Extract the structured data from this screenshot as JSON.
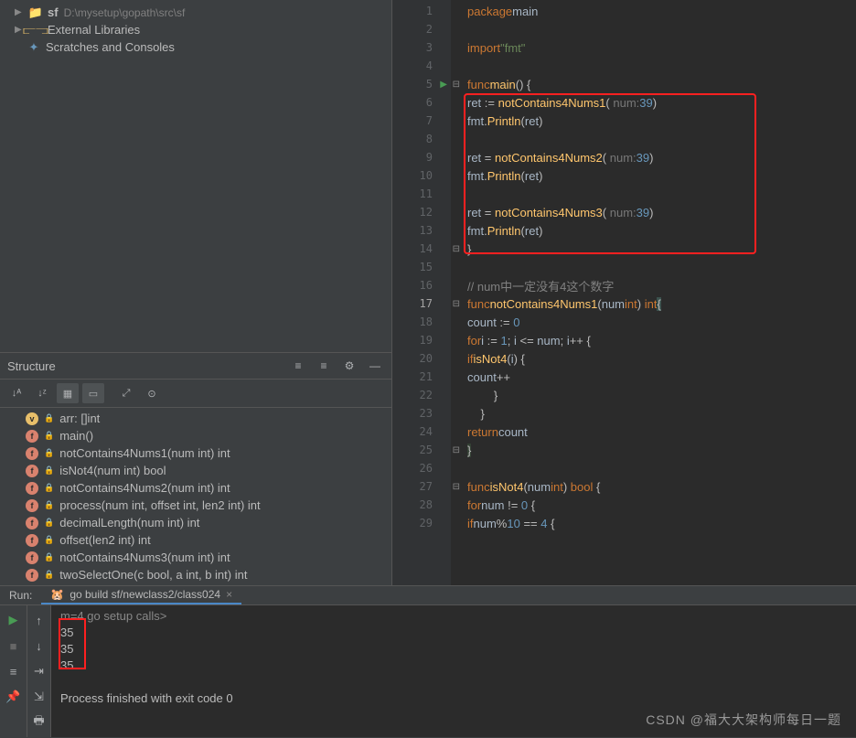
{
  "project": {
    "root_name": "sf",
    "root_path": "D:\\mysetup\\gopath\\src\\sf",
    "external_libs": "External Libraries",
    "scratches": "Scratches and Consoles"
  },
  "structure": {
    "title": "Structure",
    "items": [
      {
        "badge": "v",
        "label": "arr: []int"
      },
      {
        "badge": "f",
        "label": "main()"
      },
      {
        "badge": "f",
        "label": "notContains4Nums1(num int) int"
      },
      {
        "badge": "f",
        "label": "isNot4(num int) bool"
      },
      {
        "badge": "f",
        "label": "notContains4Nums2(num int) int"
      },
      {
        "badge": "f",
        "label": "process(num int, offset int, len2 int) int"
      },
      {
        "badge": "f",
        "label": "decimalLength(num int) int"
      },
      {
        "badge": "f",
        "label": "offset(len2 int) int"
      },
      {
        "badge": "f",
        "label": "notContains4Nums3(num int) int"
      },
      {
        "badge": "f",
        "label": "twoSelectOne(c bool, a int, b int) int"
      }
    ]
  },
  "editor": {
    "active_line": 17,
    "breadcrumb": "notContains4Nums1(num int) int",
    "lines": [
      {
        "n": 1,
        "html": "<span class='kw'>package</span> <span class='id'>main</span>"
      },
      {
        "n": 2,
        "html": ""
      },
      {
        "n": 3,
        "html": "<span class='kw'>import</span> <span class='str'>\"fmt\"</span>"
      },
      {
        "n": 4,
        "html": ""
      },
      {
        "n": 5,
        "html": "<span class='kw'>func</span> <span class='fn'>main</span>() {",
        "run": true,
        "fold": "-"
      },
      {
        "n": 6,
        "html": "    <span class='id'>ret</span> := <span class='fn'>notContains4Nums1</span>( <span class='param-hint'>num:</span> <span class='num'>39</span>)"
      },
      {
        "n": 7,
        "html": "    <span class='id'>fmt</span>.<span class='fn'>Println</span>(<span class='id'>ret</span>)"
      },
      {
        "n": 8,
        "html": ""
      },
      {
        "n": 9,
        "html": "    <span class='id'>ret</span> = <span class='fn'>notContains4Nums2</span>( <span class='param-hint'>num:</span> <span class='num'>39</span>)"
      },
      {
        "n": 10,
        "html": "    <span class='id'>fmt</span>.<span class='fn'>Println</span>(<span class='id'>ret</span>)"
      },
      {
        "n": 11,
        "html": ""
      },
      {
        "n": 12,
        "html": "    <span class='id'>ret</span> = <span class='fn'>notContains4Nums3</span>( <span class='param-hint'>num:</span> <span class='num'>39</span>)"
      },
      {
        "n": 13,
        "html": "    <span class='id'>fmt</span>.<span class='fn'>Println</span>(<span class='id'>ret</span>)"
      },
      {
        "n": 14,
        "html": "}",
        "fold": "-"
      },
      {
        "n": 15,
        "html": ""
      },
      {
        "n": 16,
        "html": "<span class='cm'>// num中一定没有4这个数字</span>"
      },
      {
        "n": 17,
        "html": "<span class='kw'>func</span> <span class='fn'>notContains4Nums1</span>(<span class='id'>num</span> <span class='kw'>int</span>) <span class='kw'>int</span> <span class='hl-br'>{</span>",
        "fold": "-"
      },
      {
        "n": 18,
        "html": "    <span class='id'>count</span> := <span class='num'>0</span>"
      },
      {
        "n": 19,
        "html": "    <span class='kw'>for</span> <span class='id'>i</span> := <span class='num'>1</span>; <span class='id'>i</span> &lt;= <span class='id'>num</span>; <span class='id'>i</span>++ {"
      },
      {
        "n": 20,
        "html": "        <span class='kw'>if</span> <span class='fn'>isNot4</span>(<span class='id'>i</span>) {"
      },
      {
        "n": 21,
        "html": "            <span class='id'>count</span>++"
      },
      {
        "n": 22,
        "html": "        }"
      },
      {
        "n": 23,
        "html": "    }"
      },
      {
        "n": 24,
        "html": "    <span class='kw'>return</span> <span class='id'>count</span>"
      },
      {
        "n": 25,
        "html": "<span class='fn-yellow hl-br'>}</span>",
        "fold": "-"
      },
      {
        "n": 26,
        "html": ""
      },
      {
        "n": 27,
        "html": "<span class='kw'>func</span> <span class='fn'>isNot4</span>(<span class='id'>num</span> <span class='kw'>int</span>) <span class='kw'>bool</span> {",
        "fold": "-"
      },
      {
        "n": 28,
        "html": "    <span class='kw'>for</span> <span class='id'>num</span> != <span class='num'>0</span> {"
      },
      {
        "n": 29,
        "html": "        <span class='kw'>if</span> <span class='id'>num</span>%<span class='num'>10</span> == <span class='num'>4</span> {"
      }
    ]
  },
  "run": {
    "label": "Run:",
    "tab": "go build sf/newclass2/class024",
    "lines": [
      "m=4 go setup calls>",
      "35",
      "35",
      "35",
      "",
      "Process finished with exit code 0"
    ]
  },
  "watermark": "CSDN @福大大架构师每日一题"
}
